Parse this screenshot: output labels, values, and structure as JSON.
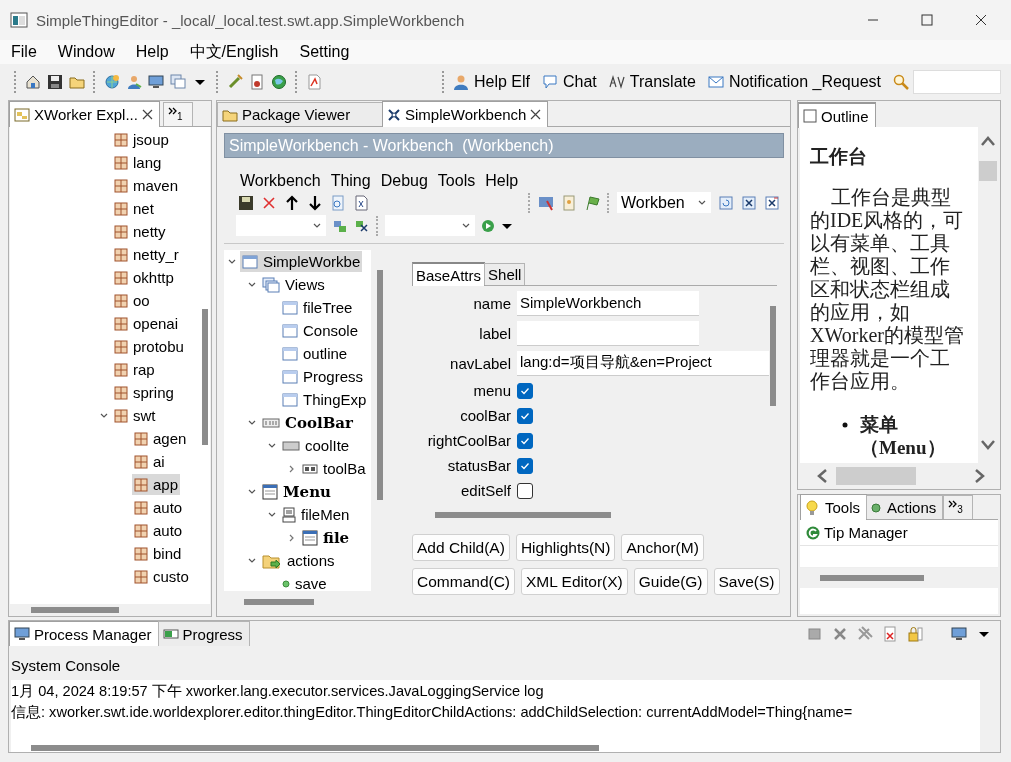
{
  "window": {
    "title": "SimpleThingEditor - _local/_local.test.swt.app.SimpleWorkbench"
  },
  "menu": [
    "File",
    "Window",
    "Help",
    "中文/English",
    "Setting"
  ],
  "toolbar": {
    "links": [
      "Help Elf",
      "Chat",
      "Translate",
      "Notification _Request"
    ]
  },
  "explorer": {
    "tabs": [
      {
        "label": "XWorker Expl...",
        "selected": true,
        "closable": true
      }
    ],
    "more_count": "1",
    "tree": [
      {
        "label": "jsoup",
        "selected": false
      },
      {
        "label": "lang",
        "selected": false
      },
      {
        "label": "maven",
        "selected": false
      },
      {
        "label": "net",
        "selected": false
      },
      {
        "label": "netty",
        "selected": false
      },
      {
        "label": "netty_r",
        "selected": false
      },
      {
        "label": "okhttp",
        "selected": false
      },
      {
        "label": "oo",
        "selected": false
      },
      {
        "label": "openai",
        "selected": false
      },
      {
        "label": "protobu",
        "selected": false
      },
      {
        "label": "rap",
        "selected": false
      },
      {
        "label": "spring",
        "selected": false
      },
      {
        "label": "swt",
        "selected": false,
        "expanded": true,
        "children": [
          {
            "label": "agen",
            "selected": false
          },
          {
            "label": "ai",
            "selected": false
          },
          {
            "label": "app",
            "selected": true
          },
          {
            "label": "auto",
            "selected": false
          },
          {
            "label": "auto",
            "selected": false
          },
          {
            "label": "bind",
            "selected": false
          },
          {
            "label": "custo",
            "selected": false
          }
        ]
      }
    ]
  },
  "editor": {
    "tabs": [
      {
        "label": "Package Viewer",
        "selected": false,
        "closable": false
      },
      {
        "label": "SimpleWorkbench",
        "selected": true,
        "closable": true
      }
    ],
    "header": "SimpleWorkbench - Workbench  (Workbench)",
    "menu": [
      "Workbench",
      "Thing",
      "Debug",
      "Tools",
      "Help"
    ],
    "combo": "Workben",
    "tree": [
      {
        "label": "SimpleWorkbe",
        "kind": "window",
        "selected": true,
        "expanded": true,
        "children": [
          {
            "label": "Views",
            "kind": "views",
            "selected": false,
            "expanded": true,
            "children": [
              {
                "label": "fileTree",
                "kind": "view",
                "selected": false
              },
              {
                "label": "Console",
                "kind": "view",
                "selected": false
              },
              {
                "label": "outline",
                "kind": "view",
                "selected": false
              },
              {
                "label": "Progress",
                "kind": "view",
                "selected": false
              },
              {
                "label": "ThingExp",
                "kind": "view",
                "selected": false
              }
            ]
          },
          {
            "label": "CoolBar",
            "kind": "coolbar",
            "bold": true,
            "selected": false,
            "expanded": true,
            "children": [
              {
                "label": "coolIte",
                "kind": "coolitem",
                "selected": false,
                "expanded": true,
                "children": [
                  {
                    "label": "toolBa",
                    "kind": "toolbar",
                    "selected": false,
                    "expanded": false
                  }
                ]
              }
            ]
          },
          {
            "label": "Menu",
            "kind": "menu",
            "bold": true,
            "selected": false,
            "expanded": true,
            "children": [
              {
                "label": "fileMen",
                "kind": "menuitem",
                "selected": false,
                "expanded": true,
                "children": [
                  {
                    "label": "file",
                    "kind": "menu",
                    "bold": true,
                    "selected": false,
                    "expanded": false
                  }
                ]
              }
            ]
          },
          {
            "label": "actions",
            "kind": "actions",
            "selected": false,
            "expanded": true,
            "children": [
              {
                "label": "save",
                "kind": "action",
                "selected": false
              }
            ]
          }
        ]
      }
    ],
    "form_tabs": [
      {
        "label": "BaseAttrs",
        "selected": true
      },
      {
        "label": "Shell",
        "selected": false
      }
    ],
    "fields": [
      {
        "kind": "text",
        "label": "name",
        "value": "SimpleWorkbench"
      },
      {
        "kind": "text",
        "label": "label"
      },
      {
        "kind": "wide",
        "label": "navLabel",
        "value": "lang:d=项目导航&en=Project"
      },
      {
        "kind": "checkbox",
        "label": "menu",
        "checked": true
      },
      {
        "kind": "checkbox",
        "label": "coolBar",
        "checked": true
      },
      {
        "kind": "checkbox",
        "label": "rightCoolBar",
        "checked": true
      },
      {
        "kind": "checkbox",
        "label": "statusBar",
        "checked": true
      },
      {
        "kind": "checkbox",
        "label": "editSelf",
        "checked": false
      }
    ],
    "buttons": [
      [
        "Add Child(A)",
        "Highlights(N)",
        "Anchor(M)"
      ],
      [
        "Command(C)",
        "XML Editor(X)",
        "Guide(G)",
        "Save(S)"
      ]
    ]
  },
  "outline": {
    "tab": "Outline",
    "heading": "工作台",
    "paragraph": "工作台是典型的IDE风格的，可以有菜单、工具栏、视图、工作区和状态栏组成的应用，如XWorker的模型管理器就是一个工作台应用。",
    "bullets": [
      "菜单（Menu）"
    ]
  },
  "tools": {
    "tabs": [
      {
        "label": "Tools",
        "selected": true
      },
      {
        "label": "Actions",
        "selected": false
      }
    ],
    "more_count": "3",
    "items": [
      "Tip Manager"
    ]
  },
  "console": {
    "tabs": [
      {
        "label": "Process Manager",
        "selected": true
      },
      {
        "label": "Progress",
        "selected": false
      }
    ],
    "title": "System Console",
    "lines": [
      "1月 04, 2024 8:19:57 下午 xworker.lang.executor.services.JavaLoggingService log",
      "信息: xworker.swt.ide.worldexplorer.editor.thingEditor.ThingEditorChildActions: addChildSelection: currentAddModel=Thing{name="
    ]
  }
}
